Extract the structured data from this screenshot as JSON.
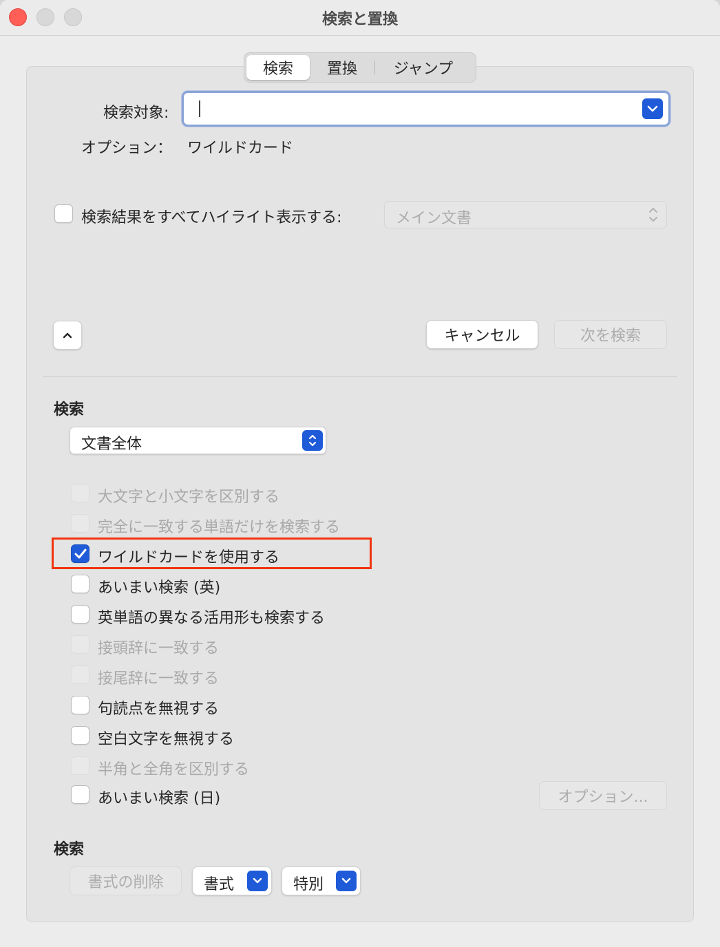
{
  "window": {
    "title": "検索と置換"
  },
  "tabs": [
    {
      "label": "検索",
      "active": true
    },
    {
      "label": "置換",
      "active": false
    },
    {
      "label": "ジャンプ",
      "active": false
    }
  ],
  "find": {
    "label": "検索対象:",
    "value": "",
    "options_label": "オプション：",
    "options_value": "ワイルドカード"
  },
  "highlight": {
    "label": "検索結果をすべてハイライト表示する:",
    "checked": false,
    "popup_value": "メイン文書"
  },
  "buttons": {
    "cancel": "キャンセル",
    "find_next": "次を検索"
  },
  "search_section": {
    "title": "検索",
    "scope_value": "文書全体",
    "options": [
      {
        "label": "大文字と小文字を区別する",
        "checked": false,
        "enabled": false
      },
      {
        "label": "完全に一致する単語だけを検索する",
        "checked": false,
        "enabled": false
      },
      {
        "label": "ワイルドカードを使用する",
        "checked": true,
        "enabled": true
      },
      {
        "label": "あいまい検索 (英)",
        "checked": false,
        "enabled": true
      },
      {
        "label": "英単語の異なる活用形も検索する",
        "checked": false,
        "enabled": true
      },
      {
        "label": "接頭辞に一致する",
        "checked": false,
        "enabled": false
      },
      {
        "label": "接尾辞に一致する",
        "checked": false,
        "enabled": false
      },
      {
        "label": "句読点を無視する",
        "checked": false,
        "enabled": true
      },
      {
        "label": "空白文字を無視する",
        "checked": false,
        "enabled": true
      },
      {
        "label": "半角と全角を区別する",
        "checked": false,
        "enabled": false
      },
      {
        "label": "あいまい検索 (日)",
        "checked": false,
        "enabled": true
      }
    ],
    "options_button": "オプション..."
  },
  "format_section": {
    "title": "検索",
    "clear_format": "書式の削除",
    "format": "書式",
    "special": "特別"
  },
  "colors": {
    "accent": "#1f5bd8",
    "highlight_border": "#f2330d"
  }
}
